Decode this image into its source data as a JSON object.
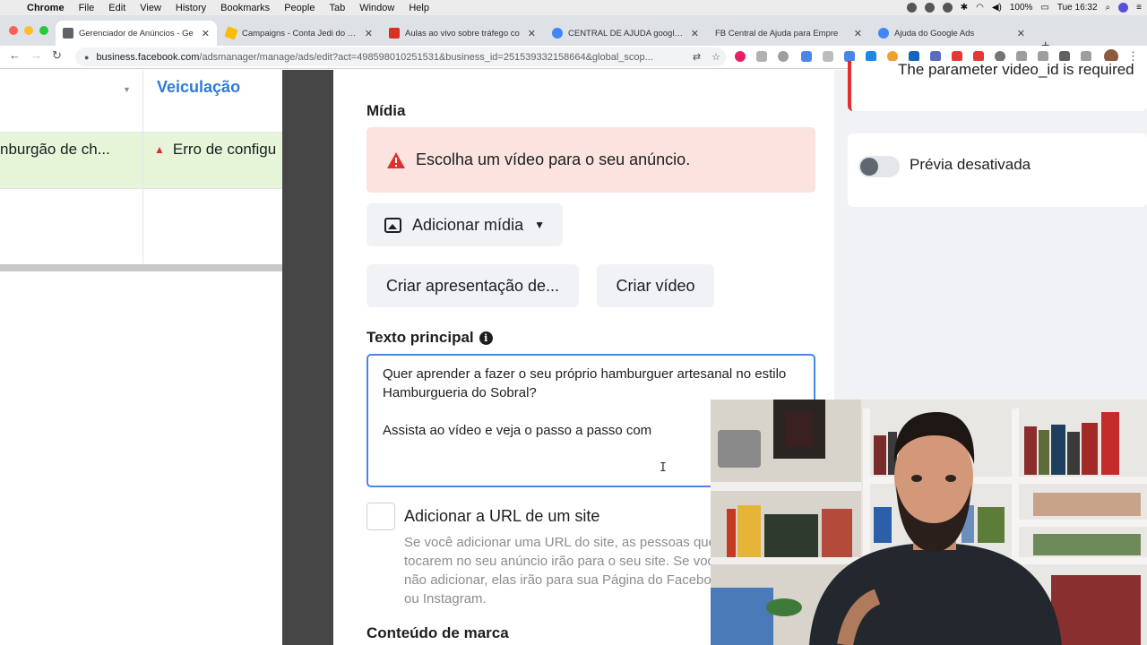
{
  "menubar": {
    "app": "Chrome",
    "items": [
      "File",
      "Edit",
      "View",
      "History",
      "Bookmarks",
      "People",
      "Tab",
      "Window",
      "Help"
    ],
    "battery": "100%",
    "clock": "Tue 16:32"
  },
  "tabs": [
    {
      "title": "Gerenciador de Anúncios - Ge",
      "active": true,
      "icon": "ads-manager-icon",
      "color": "#5f6368"
    },
    {
      "title": "Campaigns - Conta Jedi do Trá",
      "active": false,
      "icon": "google-ads-icon",
      "color": "#fbbc04"
    },
    {
      "title": "Aulas ao vivo sobre tráfego co",
      "active": false,
      "icon": "video-icon",
      "color": "#d93025"
    },
    {
      "title": "CENTRAL DE AJUDA google A",
      "active": false,
      "icon": "google-icon",
      "color": "#4285f4"
    },
    {
      "title": "FB Central de Ajuda para Empre",
      "active": false,
      "icon": "fb-icon",
      "color": "#8a8d91"
    },
    {
      "title": "Ajuda do Google Ads",
      "active": false,
      "icon": "google-icon",
      "color": "#4285f4"
    }
  ],
  "address": {
    "host": "business.facebook.com",
    "path": "/adsmanager/manage/ads/edit?act=498598010251531&business_id=251539332158664&global_scop..."
  },
  "left_table": {
    "column_title": "Veiculação",
    "row_name": "nburgão de ch...",
    "row_status": "Erro de configu"
  },
  "editor": {
    "media_title": "Mídia",
    "alert_text": "Escolha um vídeo para o seu anúncio.",
    "add_media": "Adicionar mídia",
    "create_slideshow": "Criar apresentação de...",
    "create_video": "Criar vídeo",
    "primary_text_title": "Texto principal",
    "primary_text": "Quer aprender a fazer o seu próprio hamburguer artesanal no estilo Hamburgueria do Sobral?\n\nAssista ao vídeo e veja o passo a passo com",
    "url_checkbox_label": "Adicionar a URL de um site",
    "url_help": "Se você adicionar uma URL do site, as pessoas que tocarem no seu anúncio irão para o seu site. Se você não adicionar, elas irão para sua Página do Facebook ou Instagram.",
    "brand_title": "Conteúdo de marca"
  },
  "preview": {
    "error": "The parameter video_id is required",
    "toggle_label": "Prévia desativada"
  },
  "colors": {
    "accent_blue": "#2d7bd8",
    "error_red": "#e02f2f",
    "alert_bg": "#fbe3df",
    "success_row": "#e6f5d8"
  }
}
